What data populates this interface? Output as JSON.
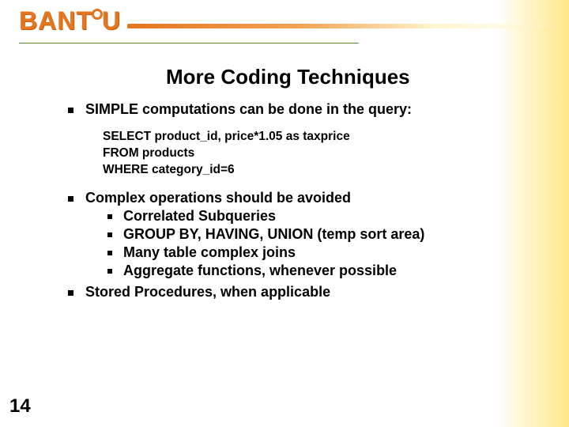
{
  "brand": {
    "prefix": "BANT",
    "suffix": "U"
  },
  "title": "More Coding Techniques",
  "bullets": {
    "b1": "SIMPLE computations can be done in the query:",
    "b2": "Complex operations should be avoided",
    "b3": "Stored Procedures, when applicable"
  },
  "code": {
    "l1": "SELECT product_id, price*1.05 as taxprice",
    "l2": "FROM products",
    "l3": "WHERE category_id=6"
  },
  "sub": {
    "s1": "Correlated Subqueries",
    "s2": "GROUP BY, HAVING, UNION (temp sort area)",
    "s3": "Many table complex joins",
    "s4": "Aggregate functions, whenever possible"
  },
  "page_number": "14"
}
